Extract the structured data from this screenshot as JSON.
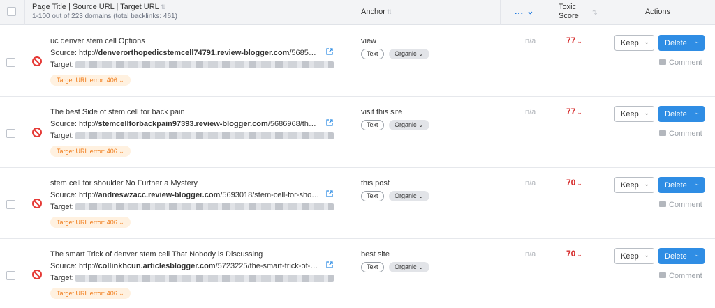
{
  "header": {
    "page_col_title": "Page Title | Source URL | Target URL",
    "page_col_subtitle": "1-100 out of 223 domains (total backlinks: 461)",
    "anchor_col": "Anchor",
    "extra_col": "...",
    "toxic_col_line1": "Toxic",
    "toxic_col_line2": "Score",
    "actions_col": "Actions"
  },
  "icons": {
    "sort": "sort-icon",
    "error": "no-entry-icon",
    "external": "external-link-icon",
    "comment": "comment-icon",
    "chevron": "chevron-down-icon"
  },
  "colors": {
    "accent": "#2f8de4",
    "toxic": "#d62d2d",
    "error_badge_bg": "#fff1e0",
    "error_badge_text": "#f07c1a"
  },
  "rows": [
    {
      "title": "uc denver stem cell Options",
      "source_prefix": "Source: http://",
      "source_domain": "denverorthopedicstemcell74791.review-blogger.com",
      "source_path": "/5685…",
      "target_label": "Target:",
      "error_badge": "Target URL error: 406",
      "anchor": "view",
      "tag_type": "Text",
      "tag_kind": "Organic",
      "extra": "n/a",
      "score": "77",
      "keep_label": "Keep",
      "delete_label": "Delete",
      "comment_label": "Comment"
    },
    {
      "title": "The best Side of stem cell for back pain",
      "source_prefix": "Source: http://",
      "source_domain": "stemcellforbackpain97393.review-blogger.com",
      "source_path": "/5686968/th…",
      "target_label": "Target:",
      "error_badge": "Target URL error: 406",
      "anchor": "visit this site",
      "tag_type": "Text",
      "tag_kind": "Organic",
      "extra": "n/a",
      "score": "77",
      "keep_label": "Keep",
      "delete_label": "Delete",
      "comment_label": "Comment"
    },
    {
      "title": "stem cell for shoulder No Further a Mystery",
      "source_prefix": "Source: http://",
      "source_domain": "andreswzacc.review-blogger.com",
      "source_path": "/5693018/stem-cell-for-sho…",
      "target_label": "Target:",
      "error_badge": "Target URL error: 406",
      "anchor": "this post",
      "tag_type": "Text",
      "tag_kind": "Organic",
      "extra": "n/a",
      "score": "70",
      "keep_label": "Keep",
      "delete_label": "Delete",
      "comment_label": "Comment"
    },
    {
      "title": "The smart Trick of denver stem cell That Nobody is Discussing",
      "source_prefix": "Source: http://",
      "source_domain": "collinkhcun.articlesblogger.com",
      "source_path": "/5723225/the-smart-trick-of-…",
      "target_label": "Target:",
      "error_badge": "Target URL error: 406",
      "anchor": "best site",
      "tag_type": "Text",
      "tag_kind": "Organic",
      "extra": "n/a",
      "score": "70",
      "keep_label": "Keep",
      "delete_label": "Delete",
      "comment_label": "Comment"
    }
  ]
}
